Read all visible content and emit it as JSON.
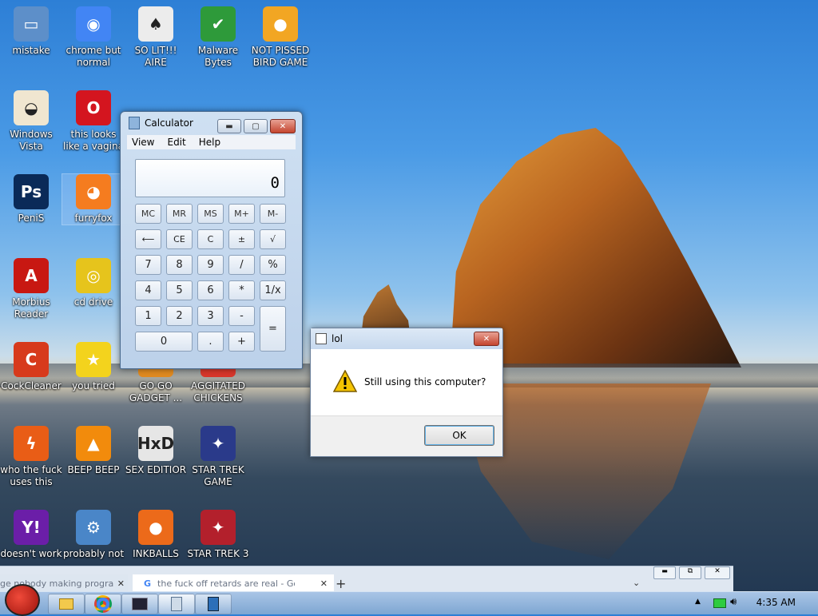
{
  "desktop": {
    "icons": [
      {
        "label": "mistake",
        "icon": "computer-icon",
        "color": "#5d8fc9"
      },
      {
        "label": "chrome but normal colors",
        "icon": "chrome-icon",
        "color": "#4285f4"
      },
      {
        "label": "SO LIT!!! AIRE",
        "icon": "solitaire-icon",
        "color": "#ececec"
      },
      {
        "label": "Malware Bytes",
        "icon": "shield-icon",
        "color": "#2e9a3a"
      },
      {
        "label": "NOT PISSED BIRD GAME",
        "icon": "bad-piggies-icon",
        "color": "#f2a623"
      },
      {
        "label": "Windows Vista",
        "icon": "egg-icon",
        "color": "#f0e6d0"
      },
      {
        "label": "this looks like a vagina lol",
        "icon": "opera-icon",
        "color": "#d4151f"
      },
      {
        "label": "PeniS",
        "icon": "photoshop-icon",
        "color": "#0a2a58"
      },
      {
        "label": "furryfox",
        "icon": "firefox-icon",
        "color": "#f57c1f"
      },
      {
        "label": "Morbius Reader",
        "icon": "acrobat-icon",
        "color": "#c81812"
      },
      {
        "label": "cd drive",
        "icon": "cd-icon",
        "color": "#e6c41c"
      },
      {
        "label": "CockCleaner",
        "icon": "ccleaner-icon",
        "color": "#d73a1c"
      },
      {
        "label": "you tried",
        "icon": "star-icon",
        "color": "#f3d31d"
      },
      {
        "label": "GO GO GADGET ...",
        "icon": "gadget-icon",
        "color": "#e08a20"
      },
      {
        "label": "AGGITATED CHICKENS I...",
        "icon": "angry-birds-icon",
        "color": "#d8372b"
      },
      {
        "label": "who the fuck uses this",
        "icon": "lightning-icon",
        "color": "#e95d16"
      },
      {
        "label": "BEEP BEEP",
        "icon": "vlc-icon",
        "color": "#f28b0c"
      },
      {
        "label": "SEX EDITIOR",
        "icon": "hxd-icon",
        "color": "#e6e6e6"
      },
      {
        "label": "STAR TREK GAME",
        "icon": "star-wars-icon",
        "color": "#2a3a8a"
      },
      {
        "label": "doesn't work",
        "icon": "yahoo-icon",
        "color": "#6b1ea8"
      },
      {
        "label": "probably not",
        "icon": "settings-icon",
        "color": "#4a86c8"
      },
      {
        "label": "INKBALLS",
        "icon": "inkball-icon",
        "color": "#ec6a1a"
      },
      {
        "label": "STAR TREK 3",
        "icon": "star-wars-3-icon",
        "color": "#b3202c"
      }
    ]
  },
  "calculator": {
    "title": "Calculator",
    "menu": [
      "View",
      "Edit",
      "Help"
    ],
    "display": "0",
    "keys": {
      "memory": [
        "MC",
        "MR",
        "MS",
        "M+",
        "M-"
      ],
      "row2": [
        "⟵",
        "CE",
        "C",
        "±",
        "√"
      ],
      "row3": [
        "7",
        "8",
        "9",
        "/",
        "%"
      ],
      "row4": [
        "4",
        "5",
        "6",
        "*",
        "1/x"
      ],
      "row5": [
        "1",
        "2",
        "3",
        "-"
      ],
      "equals": "=",
      "zero": "0",
      "dot": ".",
      "plus": "+"
    }
  },
  "dialog": {
    "title": "lol",
    "message": "Still using this computer?",
    "ok": "OK"
  },
  "browser_strip": {
    "tab1": "ge nobody making progra",
    "tab2": "the fuck off retards are real - Go",
    "new_tab": "+"
  },
  "taskbar": {
    "clock": "4:35 AM"
  }
}
